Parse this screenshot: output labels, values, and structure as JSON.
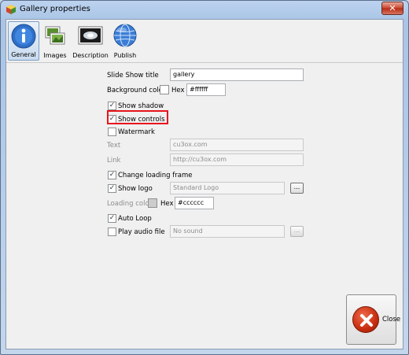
{
  "window": {
    "title": "Gallery properties"
  },
  "toolbar": {
    "tabs": [
      {
        "label": "General",
        "icon": "info-icon"
      },
      {
        "label": "Images",
        "icon": "images-icon"
      },
      {
        "label": "Description",
        "icon": "description-icon"
      },
      {
        "label": "Publish",
        "icon": "globe-icon"
      }
    ]
  },
  "form": {
    "slideshow_title": {
      "label": "Slide Show title",
      "value": "gallery"
    },
    "background_color": {
      "label": "Background color",
      "hex_label": "Hex",
      "value": "#ffffff",
      "swatch": "#ffffff"
    },
    "show_shadow": {
      "label": "Show shadow",
      "checked": true
    },
    "show_controls": {
      "label": "Show controls",
      "checked": true
    },
    "watermark": {
      "label": "Watermark",
      "checked": false
    },
    "text": {
      "label": "Text",
      "value": "cu3ox.com"
    },
    "link": {
      "label": "Link",
      "value": "http://cu3ox.com"
    },
    "change_loading_frame": {
      "label": "Change loading frame",
      "checked": true
    },
    "show_logo": {
      "label": "Show logo",
      "checked": true,
      "value": "Standard Logo",
      "browse": "..."
    },
    "loading_color": {
      "label": "Loading color",
      "hex_label": "Hex",
      "value": "#cccccc",
      "swatch": "#cccccc"
    },
    "auto_loop": {
      "label": "Auto Loop",
      "checked": true
    },
    "play_audio": {
      "label": "Play audio file",
      "checked": false,
      "value": "No sound",
      "browse": "..."
    }
  },
  "footer": {
    "close_label": "Close"
  },
  "colors": {
    "highlight": "#e8141c",
    "close_red": "#c72d0f"
  }
}
